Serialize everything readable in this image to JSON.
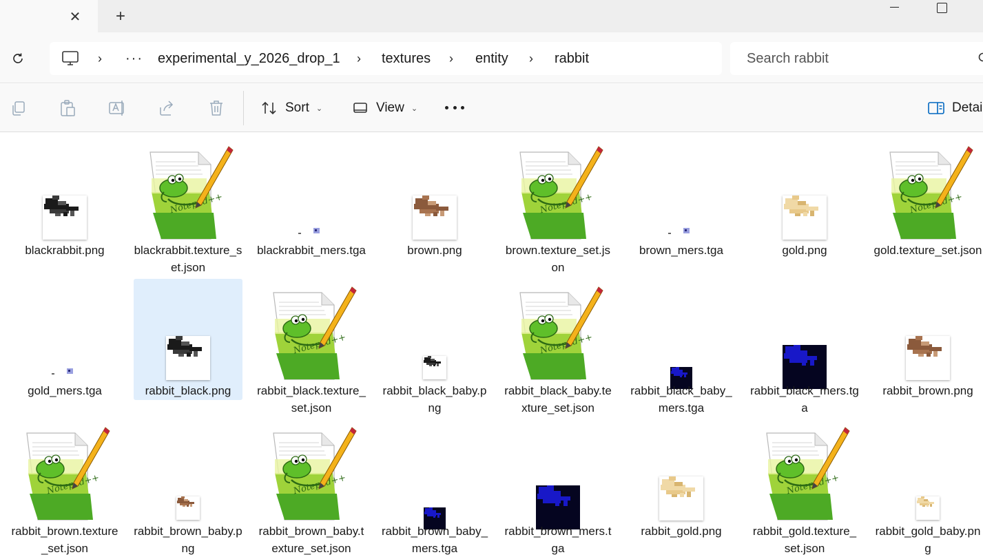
{
  "tab": {
    "close_label": "✕",
    "new_label": "+"
  },
  "address": {
    "overflow_label": "···",
    "crumbs": [
      "experimental_y_2026_drop_1",
      "textures",
      "entity",
      "rabbit"
    ],
    "chevron": "›"
  },
  "search": {
    "placeholder": "Search rabbit"
  },
  "toolbar": {
    "sort_label": "Sort",
    "view_label": "View",
    "details_label": "Detai"
  },
  "colors": {
    "accent": "#0067c0",
    "selected_bg": "#e0eefc"
  },
  "files": [
    {
      "name": "blackrabbit.png",
      "kind": "png",
      "tint": "black"
    },
    {
      "name": "blackrabbit.texture_set.json",
      "kind": "json"
    },
    {
      "name": "blackrabbit_mers.tga",
      "kind": "tga-tiny"
    },
    {
      "name": "brown.png",
      "kind": "png",
      "tint": "brown"
    },
    {
      "name": "brown.texture_set.json",
      "kind": "json"
    },
    {
      "name": "brown_mers.tga",
      "kind": "tga-tiny"
    },
    {
      "name": "gold.png",
      "kind": "png",
      "tint": "gold"
    },
    {
      "name": "gold.texture_set.json",
      "kind": "json"
    },
    {
      "name": "gold_mers.tga",
      "kind": "tga-tiny"
    },
    {
      "name": "rabbit_black.png",
      "kind": "png",
      "tint": "black",
      "selected": true
    },
    {
      "name": "rabbit_black.texture_set.json",
      "kind": "json"
    },
    {
      "name": "rabbit_black_baby.png",
      "kind": "png-small",
      "tint": "black"
    },
    {
      "name": "rabbit_black_baby.texture_set.json",
      "kind": "json"
    },
    {
      "name": "rabbit_black_baby_mers.tga",
      "kind": "tga-small"
    },
    {
      "name": "rabbit_black_mers.tga",
      "kind": "tga-big"
    },
    {
      "name": "rabbit_brown.png",
      "kind": "png",
      "tint": "brown"
    },
    {
      "name": "rabbit_brown.texture_set.json",
      "kind": "json"
    },
    {
      "name": "rabbit_brown_baby.png",
      "kind": "png-small",
      "tint": "brown"
    },
    {
      "name": "rabbit_brown_baby.texture_set.json",
      "kind": "json"
    },
    {
      "name": "rabbit_brown_baby_mers.tga",
      "kind": "tga-small"
    },
    {
      "name": "rabbit_brown_mers.tga",
      "kind": "tga-big"
    },
    {
      "name": "rabbit_gold.png",
      "kind": "png",
      "tint": "gold"
    },
    {
      "name": "rabbit_gold.texture_set.json",
      "kind": "json"
    },
    {
      "name": "rabbit_gold_baby.png",
      "kind": "png-small",
      "tint": "gold"
    }
  ]
}
